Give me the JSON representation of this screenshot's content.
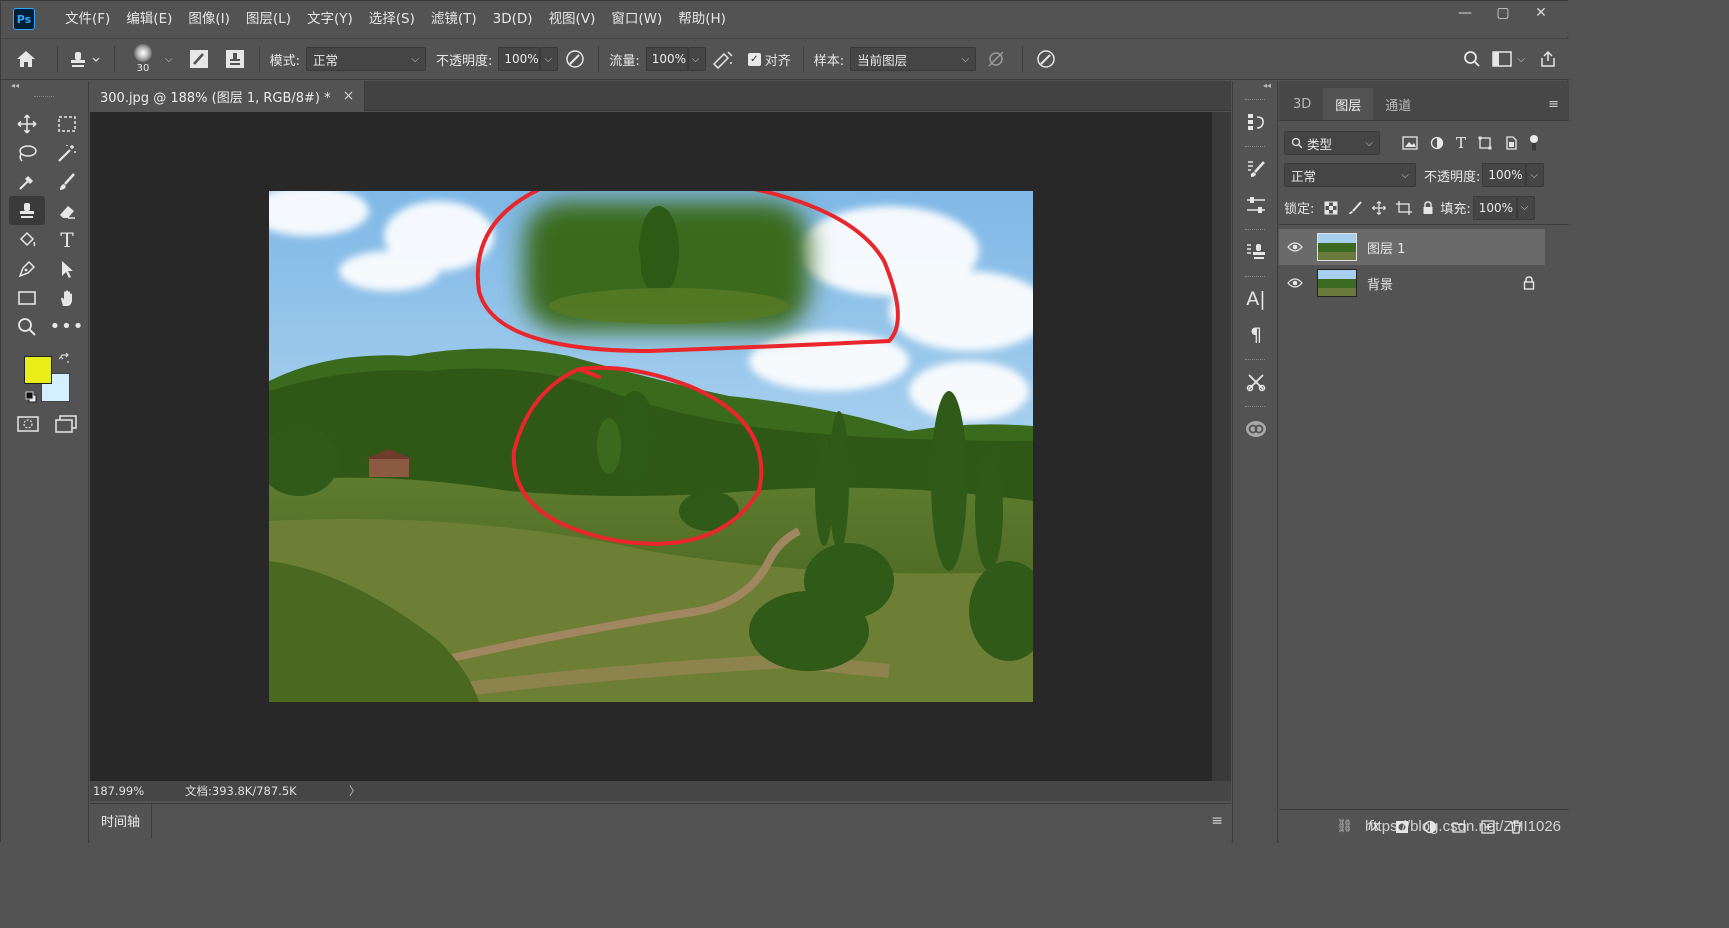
{
  "app": {
    "logo": "Ps"
  },
  "menu": [
    "文件(F)",
    "编辑(E)",
    "图像(I)",
    "图层(L)",
    "文字(Y)",
    "选择(S)",
    "滤镜(T)",
    "3D(D)",
    "视图(V)",
    "窗口(W)",
    "帮助(H)"
  ],
  "window_controls": {
    "minimize": "—",
    "maximize": "▢",
    "close": "✕"
  },
  "options": {
    "brush_size": "30",
    "mode_label": "模式:",
    "mode_value": "正常",
    "opacity_label": "不透明度:",
    "opacity_value": "100%",
    "flow_label": "流量:",
    "flow_value": "100%",
    "align_label": "对齐",
    "align_checked": true,
    "sample_label": "样本:",
    "sample_value": "当前图层"
  },
  "document": {
    "tab_title": "300.jpg @ 188% (图层 1, RGB/8#) *",
    "tab_close": "×",
    "zoom": "187.99%",
    "doc_info": "文档:393.8K/787.5K",
    "status_arrow": "〉"
  },
  "timeline": {
    "tab_label": "时间轴"
  },
  "colors": {
    "foreground": "#e9ee19",
    "background": "#d4efff",
    "annotation": "#e8262b"
  },
  "layers_panel": {
    "tabs": [
      "3D",
      "图层",
      "通道"
    ],
    "active_tab": "图层",
    "filter_label": "类型",
    "blend_mode": "正常",
    "opacity_label": "不透明度:",
    "opacity_value": "100%",
    "lock_label": "锁定:",
    "fill_label": "填充:",
    "fill_value": "100%",
    "layers": [
      {
        "name": "图层 1",
        "selected": true,
        "locked": false
      },
      {
        "name": "背景",
        "selected": false,
        "locked": true
      }
    ]
  },
  "watermark": "https://blog.csdn.net/ZHI1026"
}
